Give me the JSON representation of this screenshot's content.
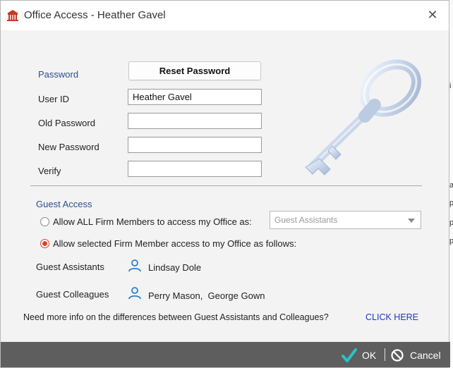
{
  "window": {
    "title": "Office Access - Heather Gavel",
    "close_glyph": "✕"
  },
  "password": {
    "section_label": "Password",
    "reset_button": "Reset Password",
    "user_id_label": "User ID",
    "user_id_value": "Heather Gavel",
    "old_password_label": "Old Password",
    "old_password_value": "",
    "new_password_label": "New Password",
    "new_password_value": "",
    "verify_label": "Verify",
    "verify_value": ""
  },
  "guest": {
    "section_label": "Guest Access",
    "option_all_label": "Allow ALL Firm Members to access my Office as:",
    "option_all_selected": false,
    "option_all_dropdown_value": "Guest Assistants",
    "option_selected_label": "Allow selected Firm Member access to my Office as follows:",
    "option_selected_selected": true,
    "assistants_label": "Guest Assistants",
    "assistants_value": "Lindsay Dole",
    "colleagues_label": "Guest Colleagues",
    "colleagues_value": "Perry Mason,  George Gown"
  },
  "info": {
    "text": "Need more info on the differences between Guest Assistants and Colleagues?",
    "link": "CLICK HERE"
  },
  "footer": {
    "ok_label": "OK",
    "cancel_label": "Cancel"
  },
  "background_marks": [
    "i",
    "a",
    "p",
    "p",
    "p"
  ],
  "colors": {
    "accent_blue": "#2d4f8c",
    "link_blue": "#1f36c8",
    "radio_checked": "#d9472a",
    "ok_check": "#29c2c8",
    "footer_bg": "#5e5e5e",
    "person_icon": "#2f7fd0"
  },
  "icons": {
    "app": "office-building-icon",
    "close": "close-icon",
    "key": "key-illustration",
    "person": "person-icon",
    "ok": "checkmark-icon",
    "cancel": "prohibited-icon"
  }
}
